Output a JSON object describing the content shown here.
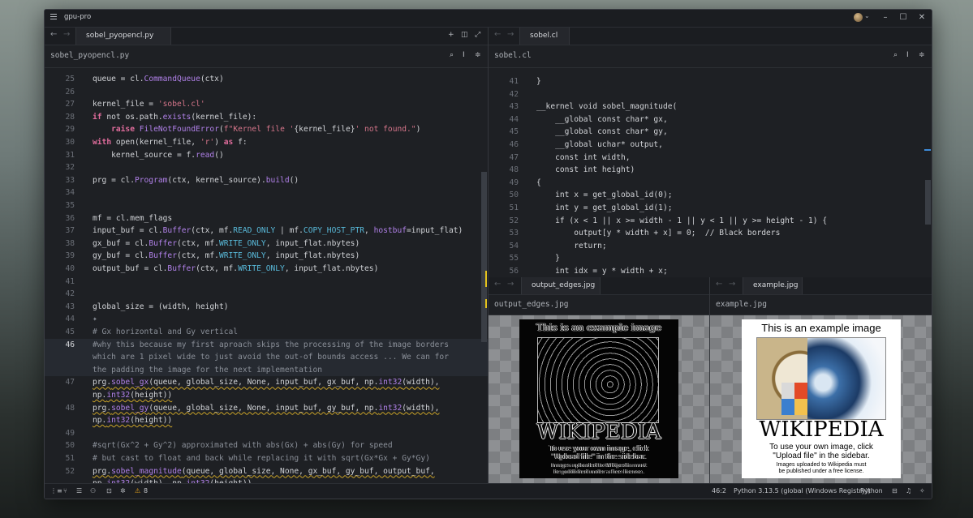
{
  "app": {
    "title": "gpu-pro"
  },
  "left_pane": {
    "tab": "sobel_pyopencl.py",
    "breadcrumb": "sobel_pyopencl.py",
    "lines": [
      {
        "n": "25",
        "html": "queue = cl.<span class=\"fn\">CommandQueue</span>(ctx)"
      },
      {
        "n": "26",
        "html": ""
      },
      {
        "n": "27",
        "html": "kernel_file = <span class=\"str\">'sobel.cl'</span>"
      },
      {
        "n": "28",
        "html": "<span class=\"kw\">if</span> not os.path.<span class=\"fn\">exists</span>(kernel_file):"
      },
      {
        "n": "29",
        "html": "    <span class=\"kw\">raise</span> <span class=\"fn\">FileNotFoundError</span>(<span class=\"str\">f\"Kernel file '</span>{kernel_file}<span class=\"str\">' not found.\"</span>)"
      },
      {
        "n": "30",
        "html": "<span class=\"kw\">with</span> open(kernel_file, <span class=\"str\">'r'</span>) <span class=\"kw\">as</span> f:"
      },
      {
        "n": "31",
        "html": "    kernel_source = f.<span class=\"fn\">read</span>()"
      },
      {
        "n": "32",
        "html": ""
      },
      {
        "n": "33",
        "html": "prg = cl.<span class=\"fn\">Program</span>(ctx, kernel_source).<span class=\"fn\">build</span>()"
      },
      {
        "n": "34",
        "html": ""
      },
      {
        "n": "35",
        "html": ""
      },
      {
        "n": "36",
        "html": "mf = cl.mem_flags"
      },
      {
        "n": "37",
        "html": "input_buf = cl.<span class=\"fn\">Buffer</span>(ctx, mf.<span class=\"const\">READ_ONLY</span> | mf.<span class=\"const\">COPY_HOST_PTR</span>, <span class=\"fn\">hostbuf</span>=input_flat)"
      },
      {
        "n": "38",
        "html": "gx_buf = cl.<span class=\"fn\">Buffer</span>(ctx, mf.<span class=\"const\">WRITE_ONLY</span>, input_flat.nbytes)"
      },
      {
        "n": "39",
        "html": "gy_buf = cl.<span class=\"fn\">Buffer</span>(ctx, mf.<span class=\"const\">WRITE_ONLY</span>, input_flat.nbytes)"
      },
      {
        "n": "40",
        "html": "output_buf = cl.<span class=\"fn\">Buffer</span>(ctx, mf.<span class=\"const\">WRITE_ONLY</span>, input_flat.nbytes)"
      },
      {
        "n": "41",
        "html": ""
      },
      {
        "n": "42",
        "html": ""
      },
      {
        "n": "43",
        "html": "global_size = (width, height)"
      },
      {
        "n": "44",
        "html": "<span class=\"cmt\">✦</span>"
      },
      {
        "n": "45",
        "html": "<span class=\"cmt\"># Gx horizontal and Gy vertical</span>"
      },
      {
        "n": "46",
        "html": "<span class=\"cmt\">#why this because my first aproach skips the processing of the image borders</span>",
        "cur": true
      },
      {
        "n": "",
        "html": "<span class=\"cmt\">which are 1 pixel wide to just avoid the out-of bounds access ... We can for</span>",
        "cur": true
      },
      {
        "n": "",
        "html": "<span class=\"cmt\">the padding the image for the next implementation</span>",
        "cur": true
      },
      {
        "n": "47",
        "html": "<span class=\"squig\">prg.<span class=\"fn\">sobel_gx</span>(queue, global_size, None, input_buf, gx_buf, np.<span class=\"fn\">int32</span>(width),</span>"
      },
      {
        "n": "",
        "html": "<span class=\"squig\">np.<span class=\"fn\">int32</span>(height))</span>"
      },
      {
        "n": "48",
        "html": "<span class=\"squig\">prg.<span class=\"fn\">sobel_gy</span>(queue, global_size, None, input_buf, gy_buf, np.<span class=\"fn\">int32</span>(width),</span>"
      },
      {
        "n": "",
        "html": "<span class=\"squig\">np.<span class=\"fn\">int32</span>(height))</span>"
      },
      {
        "n": "49",
        "html": ""
      },
      {
        "n": "50",
        "html": "<span class=\"cmt\">#sqrt(Gx^2 + Gy^2) approximated with abs(Gx) + abs(Gy) for speed</span>"
      },
      {
        "n": "51",
        "html": "<span class=\"cmt\"># but cast to float and back while replacing it with sqrt(Gx*Gx + Gy*Gy)</span>"
      },
      {
        "n": "52",
        "html": "<span class=\"squig\">prg.<span class=\"fn\">sobel_magnitude</span>(queue, global_size, None, gx_buf, gy_buf, output_buf,</span>"
      },
      {
        "n": "",
        "html": "<span class=\"squig\">np.<span class=\"fn\">int32</span>(width), np.<span class=\"fn\">int32</span>(height))</span>"
      }
    ]
  },
  "right_pane": {
    "tab": "sobel.cl",
    "breadcrumb": "sobel.cl",
    "lines": [
      {
        "n": "41",
        "html": "}"
      },
      {
        "n": "42",
        "html": ""
      },
      {
        "n": "43",
        "html": "__kernel void sobel_magnitude("
      },
      {
        "n": "44",
        "html": "    __global const char* gx,"
      },
      {
        "n": "45",
        "html": "    __global const char* gy,"
      },
      {
        "n": "46",
        "html": "    __global uchar* output,"
      },
      {
        "n": "47",
        "html": "    const int width,"
      },
      {
        "n": "48",
        "html": "    const int height)"
      },
      {
        "n": "49",
        "html": "{"
      },
      {
        "n": "50",
        "html": "    int x = get_global_id(0);"
      },
      {
        "n": "51",
        "html": "    int y = get_global_id(1);"
      },
      {
        "n": "52",
        "html": "    if (x &lt; 1 || x &gt;= width - 1 || y &lt; 1 || y &gt;= height - 1) {"
      },
      {
        "n": "53",
        "html": "        output[y * width + x] = 0;  // Black borders"
      },
      {
        "n": "54",
        "html": "        return;"
      },
      {
        "n": "55",
        "html": "    }"
      },
      {
        "n": "56",
        "html": "    int idx = y * width + x;"
      },
      {
        "n": "57",
        "html": ""
      }
    ]
  },
  "image_left": {
    "tab": "output_edges.jpg",
    "breadcrumb": "output_edges.jpg",
    "title_text": "This is an example image",
    "wordmark": "WIKIPEDIA",
    "caption1": "To use your own image, click",
    "caption2": "\"Upload file\" in the sidebar.",
    "caption3": "Images uploaded to Wikipedia must",
    "caption4": "be published under a free license."
  },
  "image_right": {
    "tab": "example.jpg",
    "breadcrumb": "example.jpg",
    "title_text": "This is an example image",
    "wordmark": "WIKIPEDIA",
    "caption1": "To use your own image, click",
    "caption2": "\"Upload file\" in the sidebar.",
    "caption3": "Images uploaded to Wikipedia must",
    "caption4": "be published under a free license."
  },
  "status": {
    "warnings": "8",
    "cursor": "46:2",
    "interpreter": "Python 3.13.5 (global (Windows Registry))",
    "language": "Python"
  },
  "icons": {
    "back": "←",
    "forward": "→",
    "plus": "+",
    "search": "🔍",
    "warning": "⚠"
  }
}
